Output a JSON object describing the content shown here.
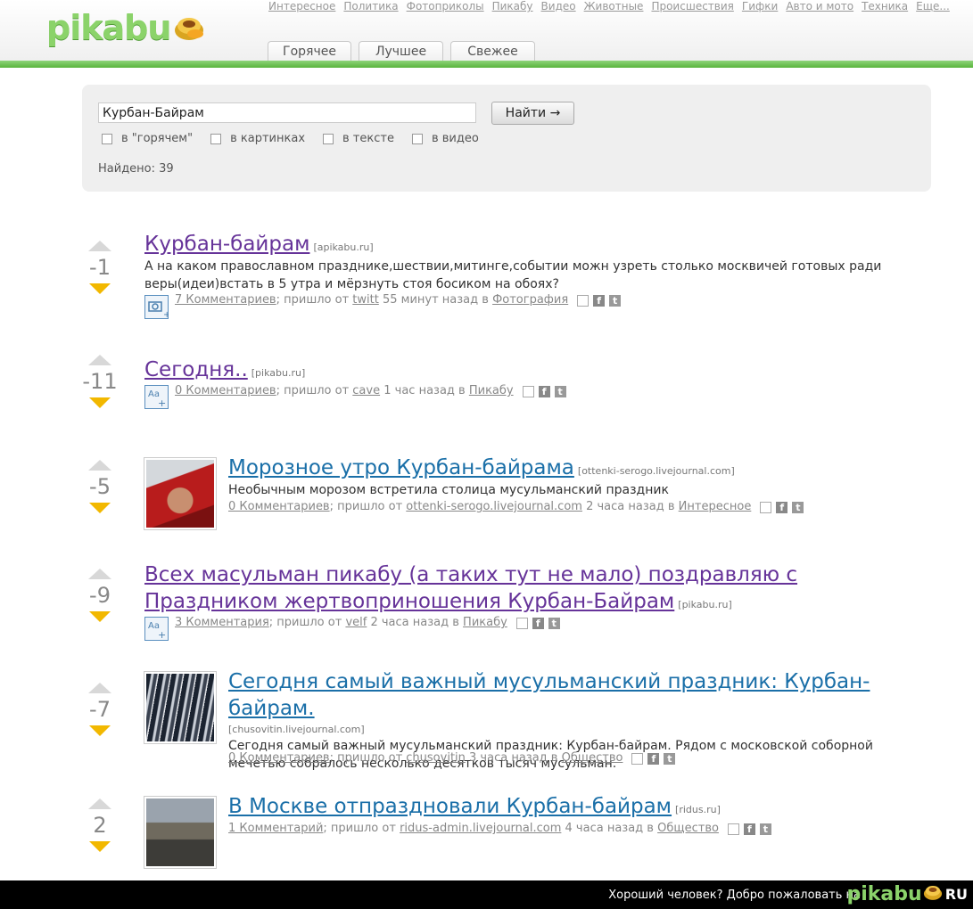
{
  "header": {
    "logo": "pikabu",
    "nav": [
      "Интересное",
      "Политика",
      "Фотоприколы",
      "Пикабу",
      "Видео",
      "Животные",
      "Происшествия",
      "Гифки",
      "Авто и мото",
      "Техника",
      "Еще..."
    ],
    "tabs": [
      "Горячее",
      "Лучшее",
      "Свежее"
    ]
  },
  "search": {
    "query": "Курбан-Байрам",
    "button": "Найти →",
    "options": [
      "в \"горячем\"",
      "в картинках",
      "в тексте",
      "в видео"
    ],
    "found": "Найдено: 39"
  },
  "posts": [
    {
      "score": "-1",
      "title": "Курбан-байрам",
      "domain": "[apikabu.ru]",
      "desc": "А на каком православном празднике,шествии,митинге,событии можн узреть столько москвичей готовых ради веры(идеи)встать в 5 утра и мёрзнуть стоя босиком на обоях?",
      "comments": "7 Комментариев",
      "from_text": "; пришло от",
      "author": "twitt",
      "time_text": "55 минут назад в",
      "category": "Фотография",
      "type_icon": "photo-icon"
    },
    {
      "score": "-11",
      "title": "Сегодня..",
      "domain": "[pikabu.ru]",
      "comments": "0 Комментариев",
      "from_text": "; пришло от",
      "author": "cave",
      "time_text": "1 час назад в",
      "category": "Пикабу",
      "type_icon": "text-icon"
    },
    {
      "score": "-5",
      "title": "Морозное утро Курбан-байрама",
      "domain": "[ottenki-serogo.livejournal.com]",
      "desc": "Необычным морозом встретила столица мусульманский праздник",
      "comments": "0 Комментариев",
      "from_text": "; пришло от",
      "author": "ottenki-serogo.livejournal.com",
      "time_text": "2 часа назад в",
      "category": "Интересное"
    },
    {
      "score": "-9",
      "title": "Всех масульман пикабу (а таких тут не мало) поздравляю с Праздником жертвоприношения Курбан-Байрам",
      "domain": "[pikabu.ru]",
      "comments": "3 Комментария",
      "from_text": "; пришло от",
      "author": "velf",
      "time_text": "2 часа назад в",
      "category": "Пикабу",
      "type_icon": "text-icon"
    },
    {
      "score": "-7",
      "title": "Сегодня самый важный мусульманский праздник: Курбан-байрам.",
      "domain": "[chusovitin.livejournal.com]",
      "desc": "Сегодня самый важный мусульманский праздник: Курбан-байрам. Рядом с московской соборной мечетью собралось несколько десятков тысяч мусульман.",
      "comments": "0 Комментариев",
      "from_text": "; пришло от",
      "author": "chusovitin",
      "time_text": "3 часа назад в",
      "category": "Общество"
    },
    {
      "score": "2",
      "title": "В Москве отпраздновали Курбан-байрам",
      "domain": "[ridus.ru]",
      "comments": "1 Комментарий",
      "from_text": "; пришло от",
      "author": "ridus-admin.livejournal.com",
      "time_text": "4 часа назад в",
      "category": "Общество"
    }
  ],
  "footer": {
    "text": "Хороший человек? Добро пожаловать на",
    "logo": "pikabu",
    "suffix": "RU"
  }
}
